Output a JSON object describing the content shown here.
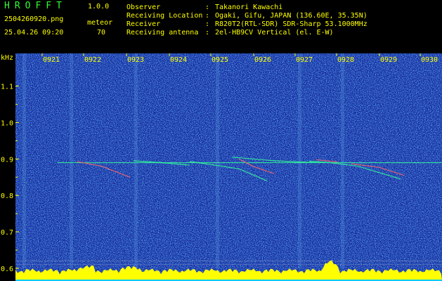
{
  "app": {
    "title": "HROFFT",
    "version": "1.0.0"
  },
  "file": {
    "name": "2504260920.png",
    "datetime": "25.04.26 09:20"
  },
  "meteor": {
    "label": "meteor",
    "count": "70"
  },
  "info": [
    {
      "label": "Observer",
      "value": "Takanori Kawachi"
    },
    {
      "label": "Receiving Location",
      "value": "Ogaki, Gifu, JAPAN (136.60E, 35.35N)"
    },
    {
      "label": "Receiver",
      "value": "R820T2(RTL-SDR) SDR-Sharp 53.1000MHz"
    },
    {
      "label": "Receiving antenna",
      "value": "2el-HB9CV Vertical (el. E-W)"
    }
  ],
  "separator": ":",
  "axis": {
    "unit": "kHz",
    "y_ticks": [
      "1.1",
      "1.0",
      "0.9",
      "0.8",
      "0.7",
      "0.6"
    ],
    "y_range": [
      0.565,
      1.19
    ],
    "time_labels": [
      "0921",
      "0922",
      "0923",
      "0924",
      "0925",
      "0926",
      "0927",
      "0928",
      "0929",
      "0930"
    ]
  },
  "colors": {
    "background": "#1a2e9e",
    "noise_dark": "#0c1e8c",
    "noise_bright": "#2fa8ff",
    "carrier": "#33ff99",
    "meteor": "#ff6a6a",
    "level": "#ffff00",
    "level_base": "#00ccff",
    "text": "#ffff00",
    "title": "#33ff33"
  },
  "chart_data": {
    "type": "heatmap",
    "ylabel": "kHz",
    "x_ticks": [
      "0921",
      "0922",
      "0923",
      "0924",
      "0925",
      "0926",
      "0927",
      "0928",
      "0929",
      "0930"
    ],
    "y_ticks": [
      1.1,
      1.0,
      0.9,
      0.8,
      0.7,
      0.6
    ],
    "ylim": [
      0.565,
      1.19
    ],
    "carrier_khz": 0.89
  }
}
